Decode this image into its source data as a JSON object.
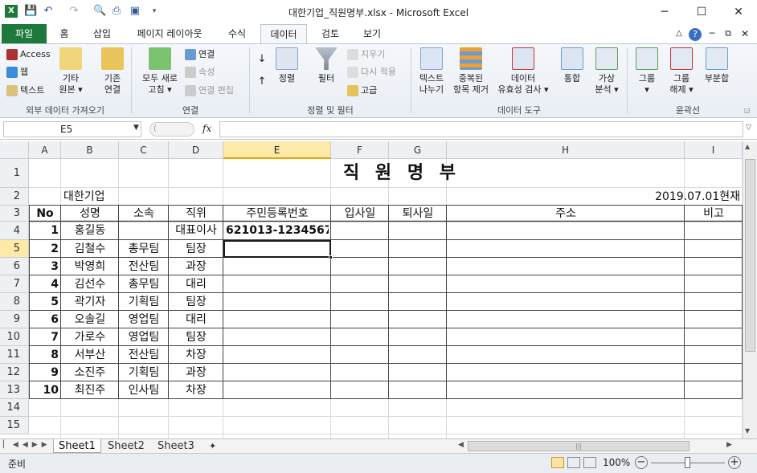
{
  "window": {
    "title": "대한기업_직원명부.xlsx - Microsoft Excel",
    "minimize": "─",
    "maximize": "☐",
    "close": "✕"
  },
  "qat": {
    "save_icon": "save-icon",
    "undo_icon": "undo-icon",
    "redo_icon": "redo-icon"
  },
  "tabs": [
    "파일",
    "홈",
    "삽입",
    "페이지 레이아웃",
    "수식",
    "데이터",
    "검토",
    "보기"
  ],
  "active_tab": "데이터",
  "ribbon": {
    "external": {
      "access": "Access",
      "web": "웹",
      "text": "텍스트",
      "other1": "기타",
      "other2": "원본",
      "existing1": "기존",
      "existing2": "연결",
      "label": "외부 데이터 가져오기"
    },
    "connections": {
      "refresh1": "모두 새로",
      "refresh2": "고침",
      "connections": "연결",
      "properties": "속성",
      "edit_links": "연결 편집",
      "label": "연결"
    },
    "sort": {
      "sort": "정렬",
      "filter": "필터",
      "clear": "지우기",
      "reapply": "다시 적용",
      "advanced": "고급",
      "label": "정렬 및 필터"
    },
    "tools": {
      "text_to_columns1": "텍스트",
      "text_to_columns2": "나누기",
      "remove_dup1": "중복된",
      "remove_dup2": "항목 제거",
      "validation1": "데이터",
      "validation2": "유효성 검사",
      "consolidate": "통합",
      "whatif1": "가상",
      "whatif2": "분석",
      "label": "데이터 도구"
    },
    "outline": {
      "group": "그룹",
      "ungroup1": "그룹",
      "ungroup2": "해제",
      "subtotal": "부분합",
      "label": "윤곽선"
    }
  },
  "formula_bar": {
    "name_box": "E5",
    "fx": "fx",
    "value": ""
  },
  "columns": [
    "A",
    "B",
    "C",
    "D",
    "E",
    "F",
    "G",
    "H",
    "I"
  ],
  "selected_column": "E",
  "selected_row": 5,
  "sheet": {
    "title": "직  원  명  부",
    "company": "대한기업",
    "date": "2019.07.01현재",
    "headers": [
      "No",
      "성명",
      "소속",
      "직위",
      "주민등록번호",
      "입사일",
      "퇴사일",
      "주소",
      "비고"
    ],
    "rows": [
      [
        "1",
        "홍길동",
        "",
        "대표이사",
        "621013-1234567",
        "",
        "",
        "",
        ""
      ],
      [
        "2",
        "김철수",
        "총무팀",
        "팀장",
        "",
        "",
        "",
        "",
        ""
      ],
      [
        "3",
        "박영희",
        "전산팀",
        "과장",
        "",
        "",
        "",
        "",
        ""
      ],
      [
        "4",
        "김선수",
        "총무팀",
        "대리",
        "",
        "",
        "",
        "",
        ""
      ],
      [
        "5",
        "곽기자",
        "기획팀",
        "팀장",
        "",
        "",
        "",
        "",
        ""
      ],
      [
        "6",
        "오솔길",
        "영업팀",
        "대리",
        "",
        "",
        "",
        "",
        ""
      ],
      [
        "7",
        "가로수",
        "영업팀",
        "팀장",
        "",
        "",
        "",
        "",
        ""
      ],
      [
        "8",
        "서부산",
        "전산팀",
        "차장",
        "",
        "",
        "",
        "",
        ""
      ],
      [
        "9",
        "소진주",
        "기획팀",
        "과장",
        "",
        "",
        "",
        "",
        ""
      ],
      [
        "10",
        "최진주",
        "인사팀",
        "차장",
        "",
        "",
        "",
        "",
        ""
      ]
    ],
    "row_numbers": [
      "1",
      "2",
      "3",
      "4",
      "5",
      "6",
      "7",
      "8",
      "9",
      "10",
      "11",
      "12",
      "13",
      "14",
      "15"
    ]
  },
  "sheet_tabs": [
    "Sheet1",
    "Sheet2",
    "Sheet3"
  ],
  "active_sheet": "Sheet1",
  "status": {
    "ready": "준비",
    "zoom": "100%"
  }
}
